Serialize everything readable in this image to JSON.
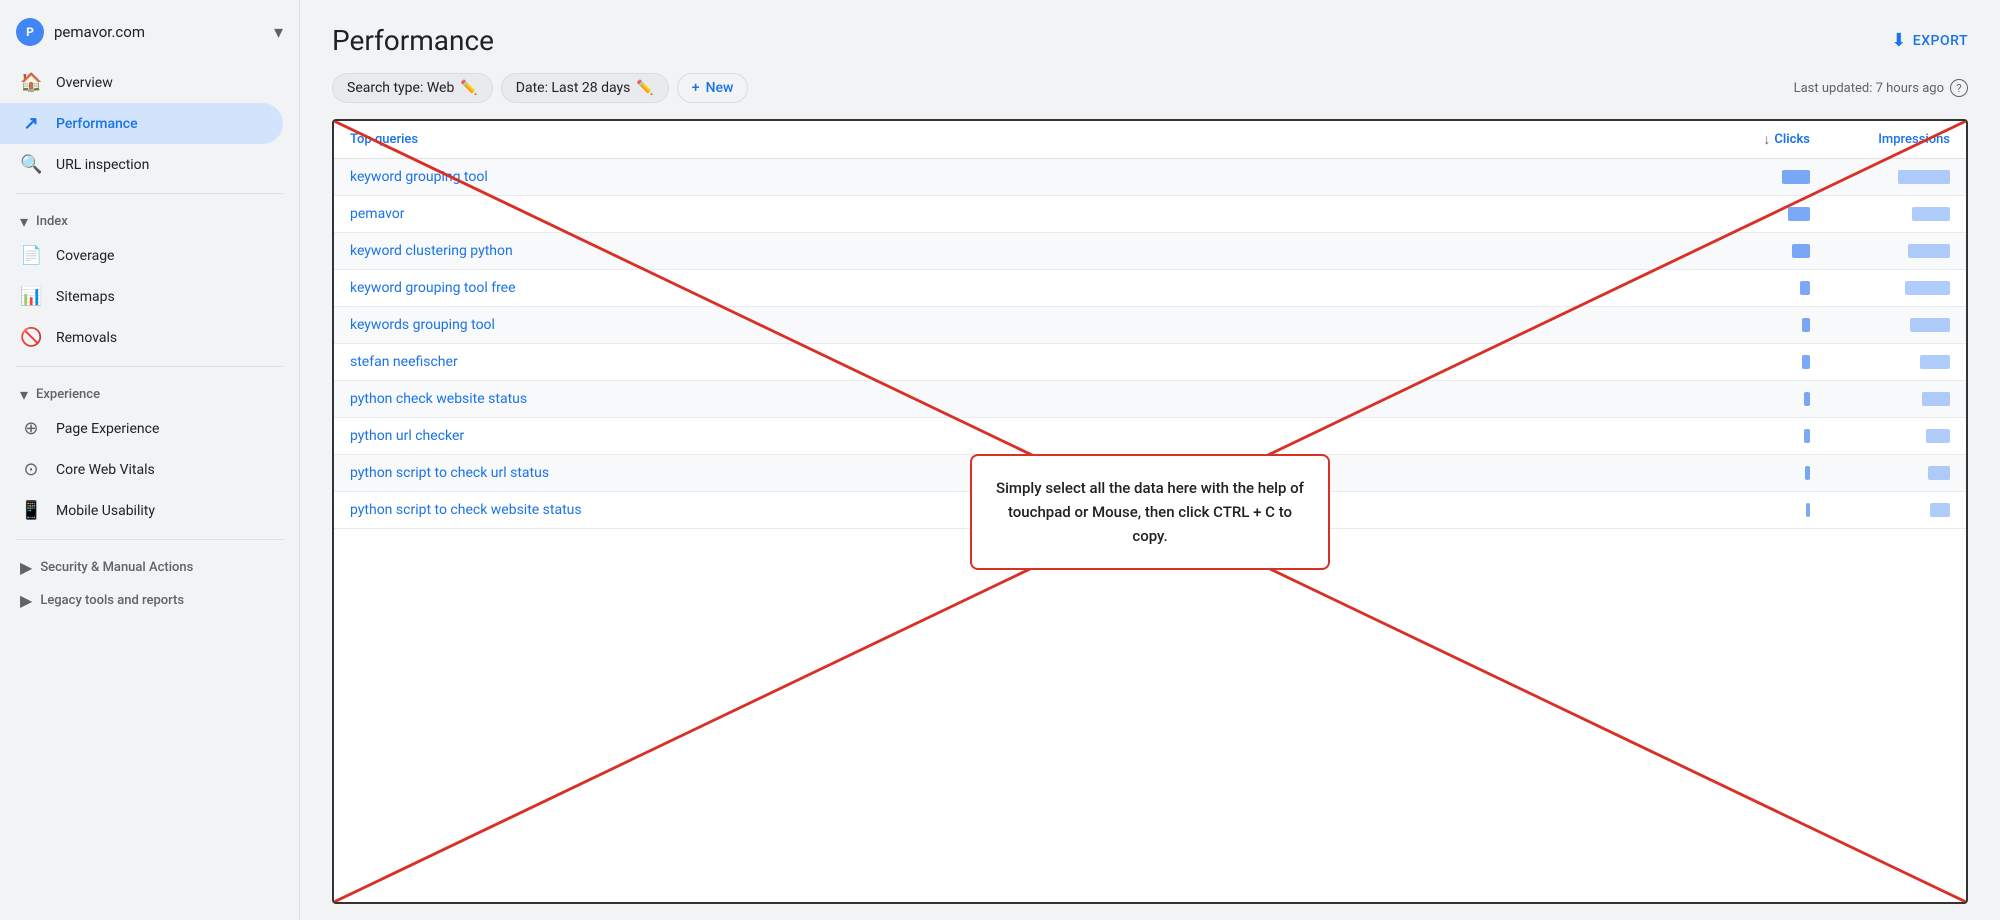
{
  "sidebar": {
    "site": {
      "name": "pemavor.com",
      "icon_label": "P"
    },
    "nav_items": [
      {
        "id": "overview",
        "label": "Overview",
        "icon": "🏠",
        "active": false
      },
      {
        "id": "performance",
        "label": "Performance",
        "icon": "↗",
        "active": true
      },
      {
        "id": "url-inspection",
        "label": "URL inspection",
        "icon": "🔍",
        "active": false
      }
    ],
    "sections": [
      {
        "label": "Index",
        "items": [
          {
            "id": "coverage",
            "label": "Coverage",
            "icon": "📄"
          },
          {
            "id": "sitemaps",
            "label": "Sitemaps",
            "icon": "📊"
          },
          {
            "id": "removals",
            "label": "Removals",
            "icon": "🚫"
          }
        ]
      },
      {
        "label": "Experience",
        "items": [
          {
            "id": "page-experience",
            "label": "Page Experience",
            "icon": "⊕"
          },
          {
            "id": "core-web-vitals",
            "label": "Core Web Vitals",
            "icon": "⊙"
          },
          {
            "id": "mobile-usability",
            "label": "Mobile Usability",
            "icon": "📱"
          }
        ]
      }
    ],
    "collapsed_sections": [
      {
        "id": "security-manual",
        "label": "Security & Manual Actions"
      },
      {
        "id": "legacy-tools",
        "label": "Legacy tools and reports"
      }
    ]
  },
  "header": {
    "title": "Performance",
    "export_label": "EXPORT"
  },
  "toolbar": {
    "search_type_label": "Search type: Web",
    "date_label": "Date: Last 28 days",
    "new_label": "New",
    "last_updated": "Last updated: 7 hours ago"
  },
  "table": {
    "col_query": "Top queries",
    "col_clicks": "Clicks",
    "col_impressions": "Impressions",
    "rows": [
      {
        "query": "keyword grouping tool",
        "clicks_width": 28,
        "impressions_width": 52
      },
      {
        "query": "pemavor",
        "clicks_width": 22,
        "impressions_width": 38
      },
      {
        "query": "keyword clustering python",
        "clicks_width": 18,
        "impressions_width": 42
      },
      {
        "query": "keyword grouping tool free",
        "clicks_width": 10,
        "impressions_width": 45
      },
      {
        "query": "keywords grouping tool",
        "clicks_width": 8,
        "impressions_width": 40
      },
      {
        "query": "stefan neefischer",
        "clicks_width": 8,
        "impressions_width": 30
      },
      {
        "query": "python check website status",
        "clicks_width": 6,
        "impressions_width": 28
      },
      {
        "query": "python url checker",
        "clicks_width": 6,
        "impressions_width": 24
      },
      {
        "query": "python script to check url status",
        "clicks_width": 5,
        "impressions_width": 22
      },
      {
        "query": "python script to check website status",
        "clicks_width": 4,
        "impressions_width": 20
      }
    ]
  },
  "tooltip": {
    "text": "Simply select all the data here with the help of touchpad or Mouse, then click CTRL + C to copy."
  }
}
